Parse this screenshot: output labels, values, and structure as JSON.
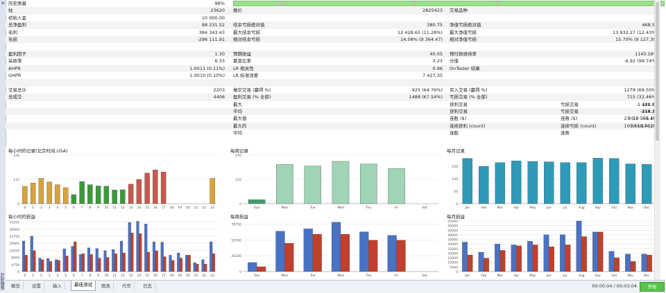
{
  "window": {
    "side_label": "策略测试",
    "close_glyph": "✕"
  },
  "quality": {
    "label": "历史质量",
    "value": "98%"
  },
  "stats": [
    [
      {
        "l": "柱",
        "v": "23620"
      },
      {
        "l": "报价",
        "v": "2825423"
      },
      {
        "l": "交易品种",
        "v": "1"
      }
    ],
    [
      {
        "l": "初始入金",
        "v": "10 000.00"
      },
      {
        "l": "",
        "v": ""
      },
      {
        "l": "",
        "v": ""
      }
    ],
    [
      {
        "l": "总净盈利",
        "v": "88 231.52"
      },
      {
        "l": "结余亏损绝对值",
        "v": "380.75"
      },
      {
        "l": "净值亏损绝对值",
        "v": "468.51"
      }
    ],
    [
      {
        "l": "毛利",
        "v": "384 343.43"
      },
      {
        "l": "最大结余亏损",
        "v": "12 428.65 (11.28%)"
      },
      {
        "l": "最大净值亏损",
        "v": "13 932.27 (12.43%)"
      }
    ],
    [
      {
        "l": "毛损",
        "v": "-296 111.91"
      },
      {
        "l": "相对结余亏损",
        "v": "14.08% (9 364.47)"
      },
      {
        "l": "相对净值亏损",
        "v": "15.70% (9 127.30)"
      }
    ],
    [
      {
        "l": "",
        "v": ""
      },
      {
        "l": "",
        "v": ""
      },
      {
        "l": "",
        "v": ""
      }
    ],
    [
      {
        "l": "盈利因子",
        "v": "1.30"
      },
      {
        "l": "预期收益",
        "v": "40.05"
      },
      {
        "l": "预付款维持率",
        "v": "1145.16%"
      }
    ],
    [
      {
        "l": "采收率",
        "v": "6.33"
      },
      {
        "l": "夏普比率",
        "v": "3.23"
      },
      {
        "l": "分值",
        "v": "-6.92 (99.74%)"
      }
    ],
    [
      {
        "l": "AHPR",
        "v": "1.0011 (0.11%)"
      },
      {
        "l": "LR 相关性",
        "v": "0.96"
      },
      {
        "l": "OnTester 结果",
        "v": "0"
      }
    ],
    [
      {
        "l": "GHPR",
        "v": "1.0010 (0.10%)"
      },
      {
        "l": "LR 标准误差",
        "v": "7 427.35"
      },
      {
        "l": "",
        "v": ""
      }
    ],
    [
      {
        "l": "",
        "v": ""
      },
      {
        "l": "",
        "v": ""
      },
      {
        "l": "",
        "v": ""
      }
    ],
    [
      {
        "l": "交易总计",
        "v": "2203"
      },
      {
        "l": "做空交易 (赢得 %)",
        "v": "925 (64.76%)"
      },
      {
        "l": "买入交易 (赢得 %)",
        "v": "1278 (69.50%)"
      }
    ],
    [
      {
        "l": "总成交",
        "v": "4406"
      },
      {
        "l": "盈利交易 (% 全部)",
        "v": "1488 (67.54%)"
      },
      {
        "l": "亏损交易 (% 全部)",
        "v": "715 (32.46%)"
      }
    ],
    [
      {
        "l": "",
        "v": ""
      },
      {
        "l": "最大",
        "v": ""
      },
      {
        "l": "获利交易",
        "v": "1 401.07"
      }
    ],
    [
      {
        "l": "",
        "v": ""
      },
      {
        "l": "平均",
        "v": ""
      },
      {
        "l": "获利交易",
        "v": "258.30"
      }
    ],
    [
      {
        "l": "",
        "v": ""
      },
      {
        "l": "最大值",
        "v": ""
      },
      {
        "l": "连胜 ($)",
        "v": "27 (10 561.17)"
      }
    ],
    [
      {
        "l": "",
        "v": ""
      },
      {
        "l": "最大的",
        "v": ""
      },
      {
        "l": "连续获利 (count)",
        "v": "10 561.17 (27)"
      }
    ],
    [
      {
        "l": "",
        "v": ""
      },
      {
        "l": "平均",
        "v": ""
      },
      {
        "l": "连胜",
        "v": "4"
      }
    ]
  ],
  "stats_right": [
    {
      "row": 13,
      "l": "亏损交易",
      "v": "-1 110.30"
    },
    {
      "row": 14,
      "l": "亏损交易",
      "v": "-414.14"
    },
    {
      "row": 15,
      "l": "连败 ($)",
      "v": "6 (-5 556.46)"
    },
    {
      "row": 16,
      "l": "连续亏损 (count)",
      "v": "-5 558.46 (6)"
    },
    {
      "row": 17,
      "l": "连败",
      "v": "2"
    }
  ],
  "chart_data": [
    {
      "type": "bar",
      "title": "每小时的记录(北京时间,USA)",
      "categories": [
        "0",
        "1",
        "2",
        "3",
        "4",
        "5",
        "6",
        "7",
        "8",
        "9",
        "10",
        "11",
        "12",
        "13",
        "14",
        "15",
        "16",
        "17",
        "18",
        "19",
        "20",
        "21",
        "22",
        "23"
      ],
      "values": [
        82,
        98,
        120,
        103,
        90,
        76,
        43,
        105,
        90,
        84,
        83,
        65,
        66,
        93,
        115,
        145,
        160,
        150,
        0,
        0,
        0,
        0,
        0,
        120
      ],
      "colors": [
        "#d9a23b",
        "#d9a23b",
        "#d9a23b",
        "#d9a23b",
        "#d9a23b",
        "#d9a23b",
        "#3a9a3a",
        "#3a9a3a",
        "#3a9a3a",
        "#3a9a3a",
        "#3a9a3a",
        "#3a9a3a",
        "#3a9a3a",
        "#c9584e",
        "#c9584e",
        "#c9584e",
        "#c9584e",
        "#c9584e",
        "#c9584e",
        "#c9584e",
        "#c9584e",
        "#c9584e",
        "#c9584e",
        "#d9a23b"
      ],
      "yticks": [
        "0",
        "115",
        "230"
      ],
      "ylim": [
        0,
        230
      ]
    },
    {
      "type": "bar",
      "title": "每周记录",
      "categories": [
        "Sun",
        "Mon",
        "Tue",
        "Wed",
        "Thu",
        "Fri",
        "Sat"
      ],
      "values": [
        38,
        380,
        365,
        410,
        385,
        340,
        0
      ],
      "colors": [
        "#3fa06a",
        "#9fd4b4",
        "#9fd4b4",
        "#9fd4b4",
        "#9fd4b4",
        "#9fd4b4",
        "#9fd4b4"
      ],
      "yticks": [
        "0",
        "235",
        "470"
      ],
      "ylim": [
        0,
        470
      ]
    },
    {
      "type": "bar",
      "title": "每月记录",
      "categories": [
        "Jan",
        "Feb",
        "Mar",
        "Apr",
        "May",
        "Jun",
        "Jul",
        "Aug",
        "Sep",
        "Oct",
        "Nov",
        "Dec"
      ],
      "values": [
        182,
        150,
        165,
        172,
        170,
        168,
        165,
        165,
        183,
        182,
        160,
        158
      ],
      "colors": [
        "#2f9ab8",
        "#2f9ab8",
        "#2f9ab8",
        "#2f9ab8",
        "#2f9ab8",
        "#2f9ab8",
        "#2f9ab8",
        "#2f9ab8",
        "#2f9ab8",
        "#2f9ab8",
        "#2f9ab8",
        "#2f9ab8"
      ],
      "yticks": [
        "0",
        "50",
        "100",
        "150"
      ],
      "ylim": [
        0,
        195
      ]
    },
    {
      "type": "bar",
      "title": "每小时的损益",
      "categories": [
        "0",
        "1",
        "2",
        "3",
        "4",
        "5",
        "6",
        "7",
        "8",
        "9",
        "10",
        "11",
        "12",
        "13",
        "14",
        "15",
        "16",
        "17",
        "18",
        "19",
        "20",
        "21",
        "22",
        "23"
      ],
      "series": [
        {
          "name": "",
          "color": "#4a72c4",
          "values": [
            20500,
            23800,
            9000,
            8800,
            8000,
            15300,
            17000,
            11500,
            16000,
            15500,
            14000,
            14800,
            20500,
            33000,
            33800,
            32000,
            20000,
            19800,
            11000,
            12500,
            11000,
            6000,
            8000,
            20000
          ]
        },
        {
          "name": "",
          "color": "#c0402e",
          "values": [
            11000,
            14000,
            8000,
            6800,
            7500,
            10500,
            20000,
            12000,
            11500,
            9000,
            9500,
            12000,
            12500,
            26000,
            25500,
            13000,
            14000,
            10000,
            7500,
            9000,
            11000,
            5000,
            5000,
            12000
          ]
        }
      ],
      "yticks": [
        "0",
        "4750",
        "9500",
        "14250",
        "19000",
        "23750",
        "28500",
        "33250"
      ],
      "ylim": [
        0,
        34000
      ]
    },
    {
      "type": "bar",
      "title": "每周损益",
      "categories": [
        "Sun",
        "Mon",
        "Tue",
        "Wed",
        "Thu",
        "Fri",
        "Sat"
      ],
      "series": [
        {
          "name": "",
          "color": "#4a72c4",
          "values": [
            15000,
            67000,
            71000,
            82000,
            66000,
            60000,
            0
          ]
        },
        {
          "name": "",
          "color": "#c0402e",
          "values": [
            8000,
            47000,
            62000,
            62000,
            52000,
            52000,
            0
          ]
        }
      ],
      "yticks": [
        "0",
        "26250",
        "52500",
        "78750"
      ],
      "ylim": [
        0,
        84000
      ]
    },
    {
      "type": "bar",
      "title": "每月损益",
      "categories": [
        "Jan",
        "Feb",
        "Mar",
        "Apr",
        "May",
        "Jun",
        "Jul",
        "Aug",
        "Sep",
        "Oct",
        "Nov",
        "Dec"
      ],
      "series": [
        {
          "name": "",
          "color": "#4a72c4",
          "values": [
            32000,
            21000,
            30000,
            29000,
            33000,
            40000,
            40000,
            55000,
            43000,
            22000,
            19000,
            19000
          ]
        },
        {
          "name": "",
          "color": "#c0402e",
          "values": [
            18000,
            14500,
            23000,
            28000,
            29000,
            27000,
            29000,
            38000,
            43000,
            15000,
            11000,
            18000
          ]
        }
      ],
      "yticks": [
        "0",
        "5000",
        "10000",
        "15000",
        "20000",
        "25000",
        "30000",
        "35000",
        "40000",
        "45000",
        "50000",
        "55000"
      ],
      "ylim": [
        0,
        55000
      ]
    }
  ],
  "tabs": [
    "概览",
    "设置",
    "输入",
    "最佳测试",
    "图表",
    "代币",
    "日志"
  ],
  "active_tab": 3,
  "timer": "00:00:04 / 00:03:04",
  "start_button": "开始"
}
